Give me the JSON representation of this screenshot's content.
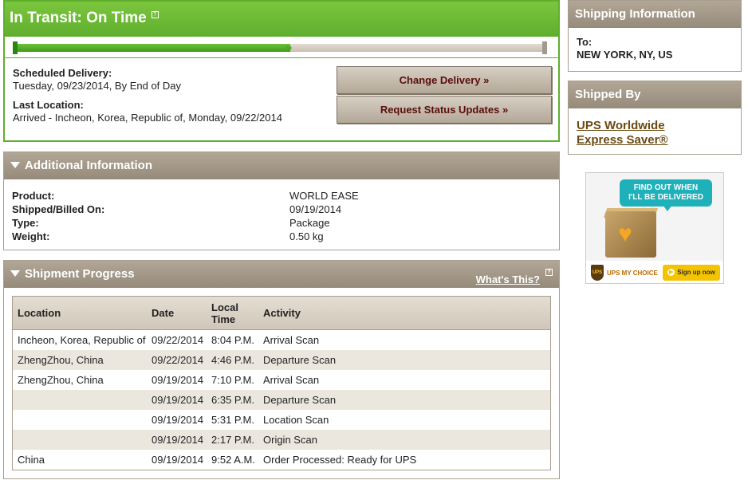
{
  "transit": {
    "title": "In Transit: On Time",
    "help": "?",
    "progress": 0.52,
    "scheduled_label": "Scheduled Delivery:",
    "scheduled_value": "Tuesday, 09/23/2014, By End of Day",
    "last_location_label": "Last Location:",
    "last_location_value": "Arrived - Incheon, Korea, Republic of, Monday, 09/22/2014",
    "change_delivery": "Change Delivery »",
    "request_updates": "Request Status Updates »"
  },
  "additional": {
    "title": "Additional Information",
    "rows": [
      {
        "label": "Product:",
        "value": "WORLD EASE"
      },
      {
        "label": "Shipped/Billed On:",
        "value": "09/19/2014"
      },
      {
        "label": "Type:",
        "value": "Package"
      },
      {
        "label": "Weight:",
        "value": "0.50 kg"
      }
    ]
  },
  "progress": {
    "title": "Shipment Progress",
    "whats_this": "What's This?",
    "help": "?",
    "columns": [
      "Location",
      "Date",
      "Local Time",
      "Activity"
    ],
    "rows": [
      [
        "Incheon, Korea, Republic of",
        "09/22/2014",
        "8:04 P.M.",
        "Arrival Scan"
      ],
      [
        "ZhengZhou, China",
        "09/22/2014",
        "4:46 P.M.",
        "Departure Scan"
      ],
      [
        "ZhengZhou, China",
        "09/19/2014",
        "7:10 P.M.",
        "Arrival Scan"
      ],
      [
        "",
        "09/19/2014",
        "6:35 P.M.",
        "Departure Scan"
      ],
      [
        "",
        "09/19/2014",
        "5:31 P.M.",
        "Location Scan"
      ],
      [
        "",
        "09/19/2014",
        "2:17 P.M.",
        "Origin Scan"
      ],
      [
        "China",
        "09/19/2014",
        "9:52 A.M.",
        "Order Processed: Ready for UPS"
      ]
    ]
  },
  "shipping_info": {
    "title": "Shipping Information",
    "to_label": "To:",
    "to_value": "NEW YORK, NY, US"
  },
  "shipped_by": {
    "title": "Shipped By",
    "service_line1": "UPS Worldwide",
    "service_line2": "Express Saver®"
  },
  "ad": {
    "bubble_line1": "FIND OUT WHEN",
    "bubble_line2": "I'LL BE DELIVERED",
    "logo": "UPS",
    "brand": "UPS MY CHOICE",
    "signup": "Sign up now"
  }
}
